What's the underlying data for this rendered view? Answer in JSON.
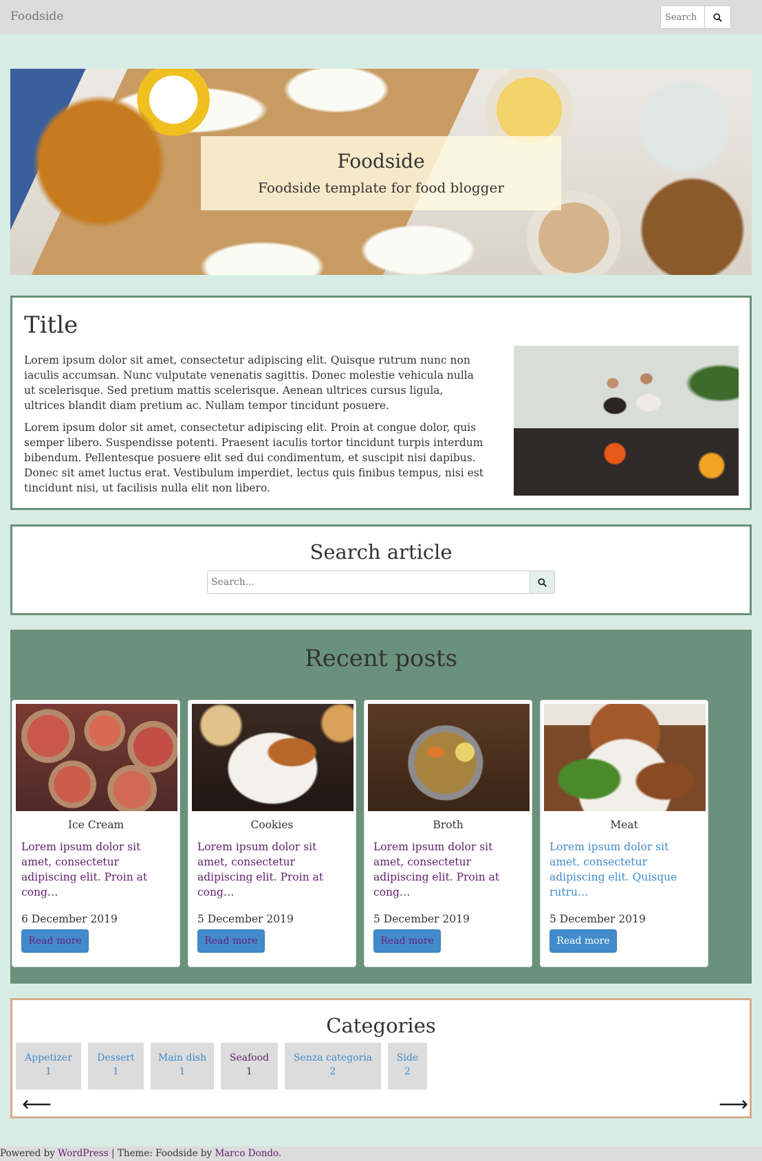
{
  "navbar": {
    "brand": "Foodside",
    "search_placeholder": "Search"
  },
  "hero": {
    "title": "Foodside",
    "subtitle": "Foodside template for food blogger"
  },
  "about": {
    "title": "Title",
    "paragraphs": [
      "Lorem ipsum dolor sit amet, consectetur adipiscing elit. Quisque rutrum nunc non iaculis accumsan. Nunc vulputate venenatis sagittis. Donec molestie vehicula nulla ut scelerisque. Sed pretium mattis scelerisque. Aenean ultrices cursus ligula, ultrices blandit diam pretium ac. Nullam tempor tincidunt posuere.",
      "Lorem ipsum dolor sit amet, consectetur adipiscing elit. Proin at congue dolor, quis semper libero. Suspendisse potenti. Praesent iaculis tortor tincidunt turpis interdum bibendum. Pellentesque posuere elit sed dui condimentum, et suscipit nisi dapibus. Donec sit amet luctus erat. Vestibulum imperdiet, lectus quis finibus tempus, nisi est tincidunt nisi, ut facilisis nulla elit non libero."
    ]
  },
  "search_article": {
    "title": "Search article",
    "placeholder": "Search..."
  },
  "recent_posts": {
    "title": "Recent posts",
    "posts": [
      {
        "title": "Ice Cream",
        "excerpt": "Lorem ipsum dolor sit amet, consectetur adipiscing elit. Proin at cong…",
        "date": "6 December 2019",
        "read_more": "Read more"
      },
      {
        "title": "Cookies",
        "excerpt": "Lorem ipsum dolor sit amet, consectetur adipiscing elit. Proin at cong…",
        "date": "5 December 2019",
        "read_more": "Read more"
      },
      {
        "title": "Broth",
        "excerpt": "Lorem ipsum dolor sit amet, consectetur adipiscing elit. Proin at cong…",
        "date": "5 December 2019",
        "read_more": "Read more"
      },
      {
        "title": "Meat",
        "excerpt": "Lorem ipsum dolor sit amet, consectetur adipiscing elit. Quisque rutru…",
        "date": "5 December 2019",
        "read_more": "Read more"
      }
    ]
  },
  "categories": {
    "title": "Categories",
    "items": [
      {
        "name": "Appetizer",
        "count": "1"
      },
      {
        "name": "Dessert",
        "count": "1"
      },
      {
        "name": "Main dish",
        "count": "1"
      },
      {
        "name": "Seafood",
        "count": "1"
      },
      {
        "name": "Senza categoria",
        "count": "2"
      },
      {
        "name": "Side",
        "count": "2"
      }
    ],
    "prev_icon": "arrow-left-icon",
    "next_icon": "arrow-right-icon"
  },
  "footer": {
    "powered_prefix": "Powered by ",
    "wordpress": "WordPress",
    "theme_text": " | Theme: Foodside by ",
    "author": "Marco Dondo",
    "suffix": "."
  },
  "colors": {
    "background": "#d8ece6",
    "accent_green": "#6a917b",
    "navbar": "#dcdcdc",
    "link_blue": "#428bca",
    "visited_purple": "#5f1f6b",
    "categories_border": "#d4ad8a"
  }
}
